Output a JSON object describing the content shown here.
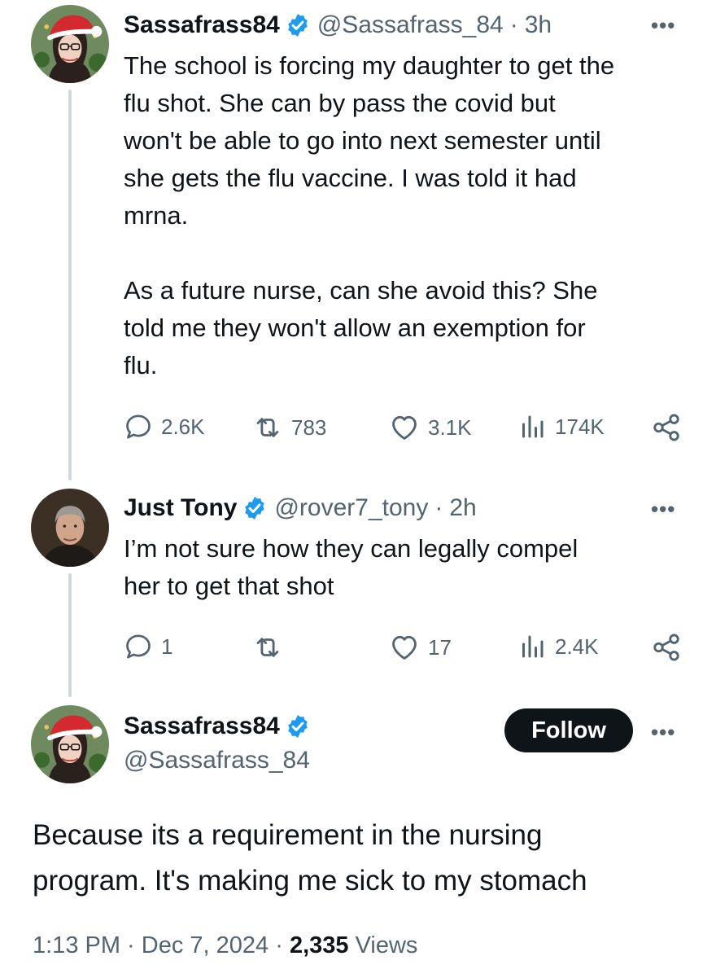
{
  "tweet1": {
    "display_name": "Sassafrass84",
    "handle": "@Sassafrass_84",
    "time": "3h",
    "text": "The school is forcing my daughter to get the\nflu shot. She can by pass the covid but\nwon't be able to go into next semester until\nshe gets the flu vaccine. I was told it had\nmrna.\n\nAs a future nurse, can she avoid this? She\ntold me they won't allow an exemption for\nflu.",
    "replies": "2.6K",
    "reposts": "783",
    "likes": "3.1K",
    "views": "174K"
  },
  "tweet2": {
    "display_name": "Just Tony",
    "handle": "@rover7_tony",
    "time": "2h",
    "text": "I’m not sure how they can legally compel\nher to get that shot",
    "replies": "1",
    "reposts": "",
    "likes": "17",
    "views": "2.4K"
  },
  "main": {
    "display_name": "Sassafrass84",
    "handle": "@Sassafrass_84",
    "follow_label": "Follow",
    "text": "Because its a requirement in the nursing\nprogram. It's making me sick to my stomach",
    "timestamp": "1:13 PM · Dec 7, 2024 · ",
    "view_count": "2,335",
    "views_label": "Views"
  },
  "ui": {
    "separator": "·",
    "more_label": "•••",
    "verified_color": "#1d9bf0",
    "icons": [
      "reply-icon",
      "repost-icon",
      "like-icon",
      "views-icon",
      "share-icon",
      "verified-badge-icon"
    ]
  }
}
